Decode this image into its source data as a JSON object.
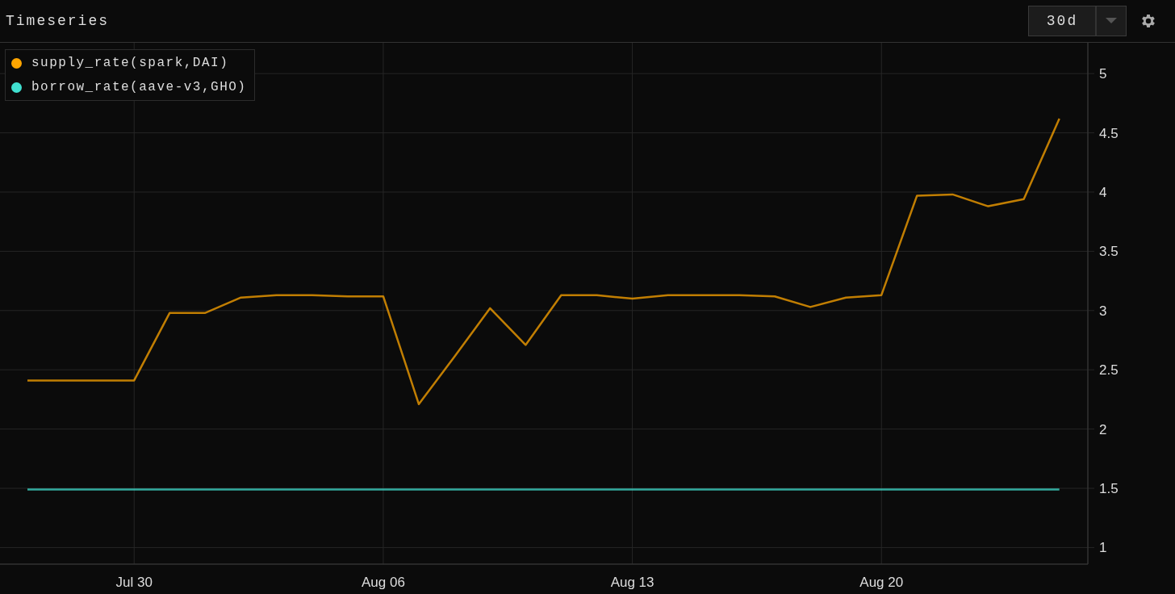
{
  "panel": {
    "title": "Timeseries",
    "range": {
      "value": "30d"
    }
  },
  "chart_data": {
    "type": "line",
    "grid": true,
    "categories": [
      null,
      null,
      null,
      "Jul 30",
      null,
      null,
      null,
      null,
      null,
      null,
      "Aug 06",
      null,
      null,
      null,
      null,
      null,
      null,
      "Aug 13",
      null,
      null,
      null,
      null,
      null,
      null,
      "Aug 20",
      null,
      null,
      null,
      null,
      null
    ],
    "series": [
      {
        "name": "supply_rate(spark,DAI)",
        "color": "#ffa500",
        "values": [
          2.41,
          2.41,
          2.41,
          2.41,
          2.98,
          2.98,
          3.11,
          3.13,
          3.13,
          3.12,
          3.12,
          2.21,
          2.61,
          3.02,
          2.71,
          3.13,
          3.13,
          3.1,
          3.13,
          3.13,
          3.13,
          3.12,
          3.03,
          3.11,
          3.13,
          3.97,
          3.98,
          3.88,
          3.94,
          4.62
        ]
      },
      {
        "name": "borrow_rate(aave-v3,GHO)",
        "color": "#40e0d0",
        "values": [
          1.49,
          1.49,
          1.49,
          1.49,
          1.49,
          1.49,
          1.49,
          1.49,
          1.49,
          1.49,
          1.49,
          1.49,
          1.49,
          1.49,
          1.49,
          1.49,
          1.49,
          1.49,
          1.49,
          1.49,
          1.49,
          1.49,
          1.49,
          1.49,
          1.49,
          1.49,
          1.49,
          1.49,
          1.49,
          1.49
        ]
      }
    ],
    "ylim": [
      0.86,
      5.26
    ],
    "yticks": [
      {
        "value": 1,
        "label": "1"
      },
      {
        "value": 1.5,
        "label": "1.5"
      },
      {
        "value": 2,
        "label": "2"
      },
      {
        "value": 2.5,
        "label": "2.5"
      },
      {
        "value": 3,
        "label": "3"
      },
      {
        "value": 3.5,
        "label": "3.5"
      },
      {
        "value": 4,
        "label": "4"
      },
      {
        "value": 4.5,
        "label": "4.5"
      },
      {
        "value": 5,
        "label": "5"
      }
    ]
  }
}
